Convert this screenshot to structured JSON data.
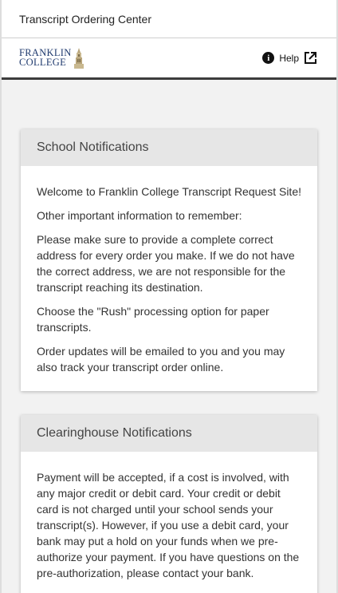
{
  "header": {
    "title": "Transcript Ordering Center"
  },
  "brand": {
    "logo_line1": "FRANKLIN",
    "logo_line2": "COLLEGE",
    "help_label": "Help",
    "primary_color": "#1f3a6e"
  },
  "school_notifications": {
    "title": "School Notifications",
    "paragraphs": [
      "Welcome to Franklin College Transcript Request Site!",
      "Other important information to remember:",
      "Please make sure to provide a complete correct address for every order you make. If we do not have the correct address, we are not responsible for the transcript reaching its destination.",
      "Choose the \"Rush\" processing option for paper transcripts.",
      "Order updates will be emailed to you and you may also track your transcript order online."
    ]
  },
  "clearinghouse_notifications": {
    "title": "Clearinghouse Notifications",
    "paragraphs": [
      "Payment will be accepted, if a cost is involved, with any major credit or debit card. Your credit or debit card is not charged until your school sends your transcript(s). However, if you use a debit card, your bank may put a hold on your funds when we pre-authorize your payment. If you have questions on the pre-authorization, please contact your bank."
    ]
  }
}
